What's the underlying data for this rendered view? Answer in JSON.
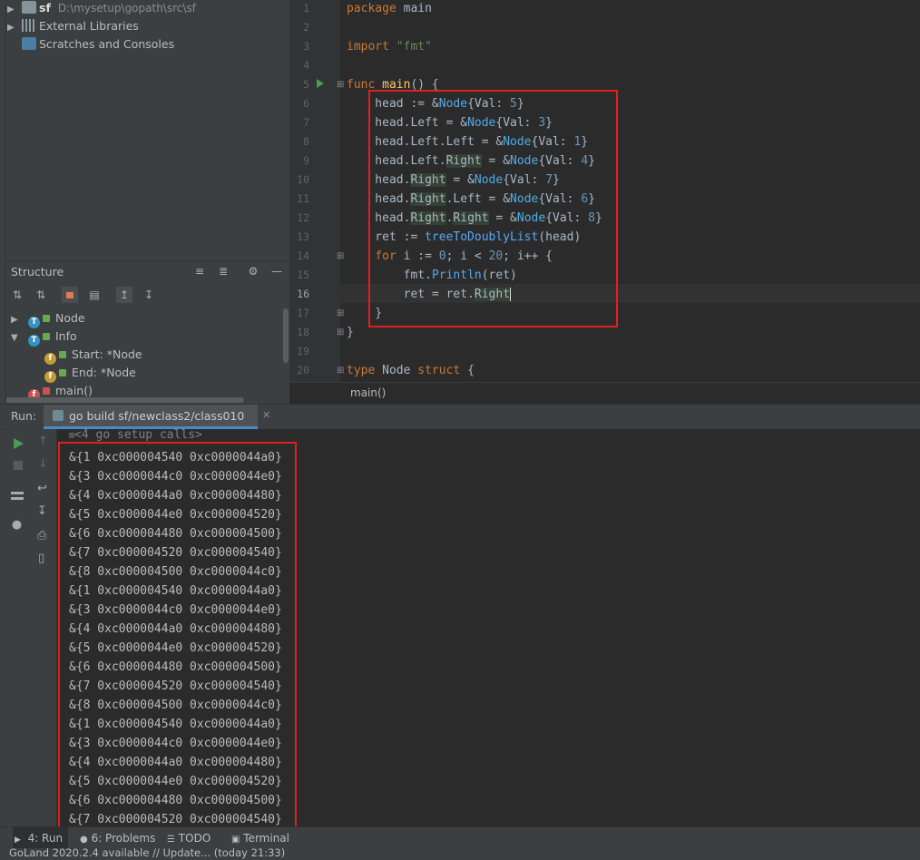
{
  "project": {
    "root_name": "sf",
    "root_path": "D:\\mysetup\\gopath\\src\\sf",
    "ext_libs": "External Libraries",
    "scratches": "Scratches and Consoles"
  },
  "structure": {
    "title": "Structure",
    "items": [
      {
        "label": "Node",
        "badge": "T"
      },
      {
        "label": "Info",
        "badge": "T"
      },
      {
        "label": "Start: *Node",
        "badge": "f"
      },
      {
        "label": "End: *Node",
        "badge": "f"
      },
      {
        "label": "main()",
        "badge": "f"
      }
    ]
  },
  "editor": {
    "line_numbers": [
      "1",
      "2",
      "3",
      "4",
      "5",
      "6",
      "7",
      "8",
      "9",
      "10",
      "11",
      "12",
      "13",
      "14",
      "15",
      "16",
      "17",
      "18",
      "19",
      "20"
    ],
    "breadcrumb": "main()"
  },
  "run": {
    "label": "Run:",
    "tab": "go build sf/newclass2/class010",
    "setup": "<4 go setup calls>",
    "output": [
      "&{1 0xc000004540 0xc0000044a0}",
      "&{3 0xc0000044c0 0xc0000044e0}",
      "&{4 0xc0000044a0 0xc000004480}",
      "&{5 0xc0000044e0 0xc000004520}",
      "&{6 0xc000004480 0xc000004500}",
      "&{7 0xc000004520 0xc000004540}",
      "&{8 0xc000004500 0xc0000044c0}",
      "&{1 0xc000004540 0xc0000044a0}",
      "&{3 0xc0000044c0 0xc0000044e0}",
      "&{4 0xc0000044a0 0xc000004480}",
      "&{5 0xc0000044e0 0xc000004520}",
      "&{6 0xc000004480 0xc000004500}",
      "&{7 0xc000004520 0xc000004540}",
      "&{8 0xc000004500 0xc0000044c0}",
      "&{1 0xc000004540 0xc0000044a0}",
      "&{3 0xc0000044c0 0xc0000044e0}",
      "&{4 0xc0000044a0 0xc000004480}",
      "&{5 0xc0000044e0 0xc000004520}",
      "&{6 0xc000004480 0xc000004500}",
      "&{7 0xc000004520 0xc000004540}"
    ]
  },
  "toolwindows": {
    "run": "4: Run",
    "problems": "6: Problems",
    "todo": "TODO",
    "terminal": "Terminal"
  },
  "status": {
    "text": "GoLand 2020.2.4 available // Update... (today 21:33)"
  },
  "colors": {
    "highlight_box": "#e02020",
    "editor_bg": "#2b2b2b",
    "panel_bg": "#3c3f41"
  }
}
